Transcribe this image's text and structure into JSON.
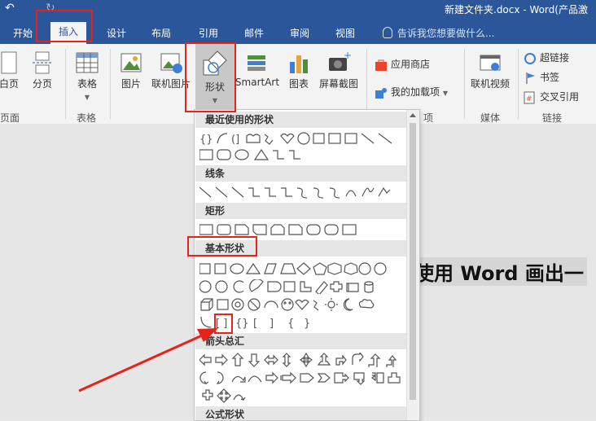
{
  "titlebar": {
    "undo": "↶",
    "redo": "↻",
    "title": "新建文件夹.docx - Word(产品激"
  },
  "tabs": [
    {
      "label": "开始"
    },
    {
      "label": "插入"
    },
    {
      "label": "设计"
    },
    {
      "label": "布局"
    },
    {
      "label": "引用"
    },
    {
      "label": "邮件"
    },
    {
      "label": "审阅"
    },
    {
      "label": "视图"
    }
  ],
  "tell_me": "告诉我您想要做什么...",
  "ribbon": {
    "pages": {
      "blank_page": "白页",
      "page_break": "分页",
      "group": "页面"
    },
    "tables": {
      "table": "表格",
      "group": "表格"
    },
    "illustrations": {
      "picture": "图片",
      "online_picture": "联机图片",
      "shapes": "形状",
      "smartart": "SmartArt",
      "chart": "图表",
      "screenshot": "屏幕截图"
    },
    "addins": {
      "store": "应用商店",
      "my_addins": "我的加载项",
      "group": "项"
    },
    "media": {
      "online_video": "联机视频",
      "group": "媒体"
    },
    "links": {
      "hyperlink": "超链接",
      "bookmark": "书签",
      "cross_ref": "交叉引用",
      "group": "链接"
    }
  },
  "gallery": {
    "sections": [
      {
        "label": "最近使用的形状"
      },
      {
        "label": "线条"
      },
      {
        "label": "矩形"
      },
      {
        "label": "基本形状"
      },
      {
        "label": "箭头总汇"
      },
      {
        "label": "公式形状"
      }
    ]
  },
  "document": {
    "visible_text": "使用 Word 画出一"
  },
  "colors": {
    "accent": "#2b579a",
    "annotation_red": "#e8221b"
  }
}
